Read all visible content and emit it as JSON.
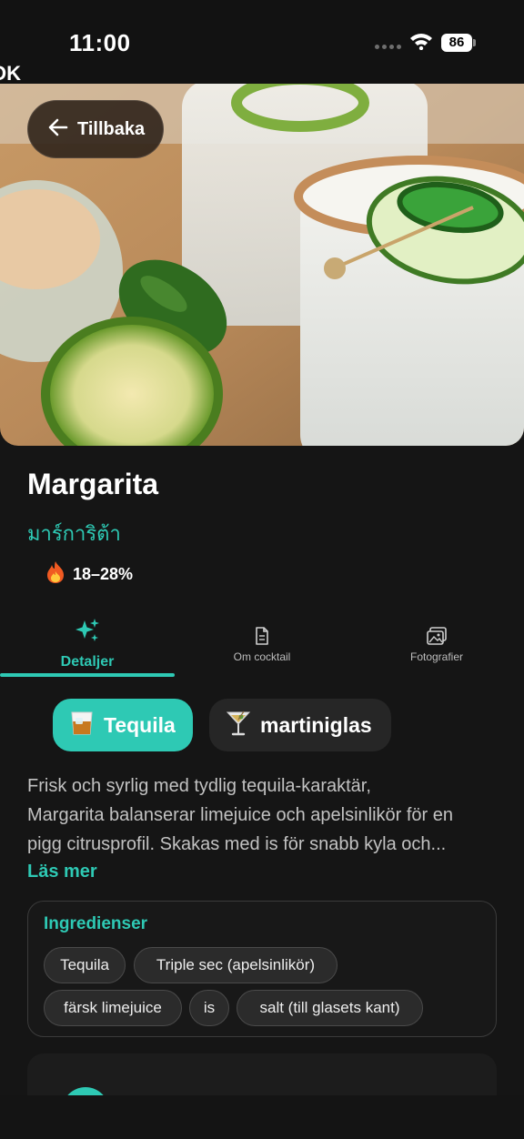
{
  "status_bar": {
    "time": "11:00",
    "battery": "86",
    "back_app_label": "OK"
  },
  "header": {
    "back_label": "Tillbaka"
  },
  "drink": {
    "name": "Margarita",
    "name_local": "มาร์การิต้า",
    "abv": "18–28%"
  },
  "tabs": [
    {
      "label": "Detaljer",
      "icon": "sparkles-icon",
      "active": true
    },
    {
      "label": "Om cocktail",
      "icon": "document-icon",
      "active": false
    },
    {
      "label": "Fotografier",
      "icon": "photos-icon",
      "active": false
    }
  ],
  "chips": {
    "spirit": {
      "label": "Tequila",
      "icon": "tumbler-glass-icon"
    },
    "glass": {
      "label": "martiniglas",
      "icon": "cocktail-glass-icon"
    }
  },
  "description": {
    "lines": [
      "Frisk och syrlig med tydlig tequila-karaktär,",
      "Margarita balanserar limejuice och apelsinlikör för en",
      "pigg citrusprofil. Skakas med is för snabb kyla och..."
    ],
    "read_more": "Läs mer"
  },
  "ingredients": {
    "title": "Ingredienser",
    "items": [
      "Tequila",
      "Triple sec (apelsinlikör)",
      "färsk limejuice",
      "is",
      "salt (till glasets kant)"
    ]
  },
  "colors": {
    "accent": "#2ec9b4",
    "background": "#151515",
    "card": "#262626"
  }
}
